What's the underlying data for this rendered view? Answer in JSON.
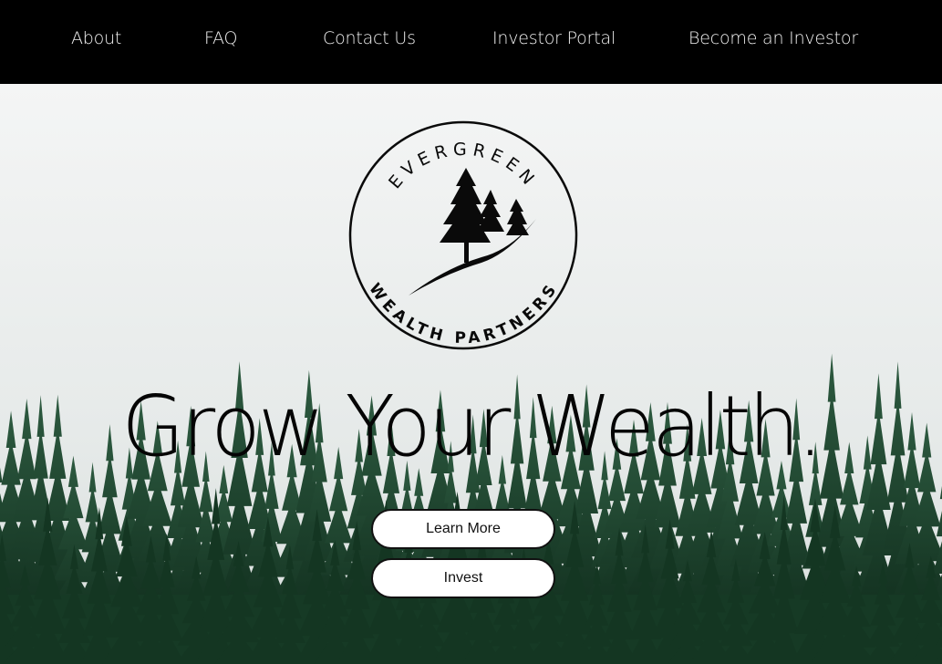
{
  "nav": {
    "items": [
      {
        "label": "About"
      },
      {
        "label": "FAQ"
      },
      {
        "label": "Contact Us"
      },
      {
        "label": "Investor Portal"
      },
      {
        "label": "Become an Investor"
      }
    ]
  },
  "logo": {
    "top_text": "EVERGREEN",
    "bottom_text": "WEALTH PARTNERS"
  },
  "hero": {
    "headline": "Grow Your Wealth.",
    "learn_more_label": "Learn More",
    "invest_label": "Invest"
  },
  "colors": {
    "nav_bg": "#000000",
    "nav_text": "#f2f2f2",
    "sky": "#eef0ef",
    "forest": "#1f4a33",
    "button_bg": "#ffffff",
    "button_border": "#111111"
  }
}
